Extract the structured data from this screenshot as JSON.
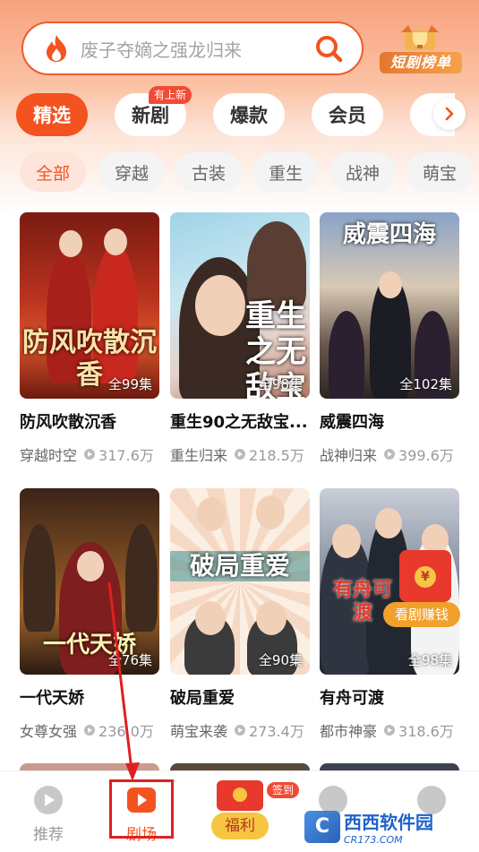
{
  "search": {
    "placeholder": "废子夺嫡之强龙归来"
  },
  "rank_badge": {
    "label": "短剧榜单"
  },
  "tabs": [
    {
      "label": "精选",
      "active": true
    },
    {
      "label": "新剧",
      "tag": "有上新"
    },
    {
      "label": "爆款"
    },
    {
      "label": "会员"
    }
  ],
  "filters": [
    "全部",
    "穿越",
    "古装",
    "重生",
    "战神",
    "萌宝"
  ],
  "cards": [
    {
      "title": "防风吹散沉香",
      "poster_text": "防风吹散沉香",
      "episodes": "全99集",
      "genre": "穿越时空",
      "views": "317.6万"
    },
    {
      "title": "重生90之无敌宝...",
      "poster_text": "重生之无敌宝",
      "episodes": "全98集",
      "genre": "重生归来",
      "views": "218.5万"
    },
    {
      "title": "威震四海",
      "poster_text": "威震四海",
      "episodes": "全102集",
      "genre": "战神归来",
      "views": "399.6万"
    },
    {
      "title": "一代天娇",
      "poster_text": "一代天娇",
      "episodes": "全76集",
      "genre": "女尊女强",
      "views": "236.0万"
    },
    {
      "title": "破局重爱",
      "poster_text": "破局重爱",
      "episodes": "全90集",
      "genre": "萌宝来袭",
      "views": "273.4万"
    },
    {
      "title": "有舟可渡",
      "poster_text": "有舟可渡",
      "episodes": "全98集",
      "genre": "都市神豪",
      "views": "318.6万"
    }
  ],
  "red_packet": {
    "coin": "¥",
    "label": "看剧赚钱"
  },
  "bottom_nav": [
    {
      "label": "推荐"
    },
    {
      "label": "剧场",
      "active": true
    },
    {
      "label": "福利",
      "tag": "签到"
    },
    {
      "label": ""
    },
    {
      "label": ""
    }
  ],
  "watermark": {
    "name": "西西软件园",
    "url": "CR173.COM"
  },
  "colors": {
    "accent": "#f2531f",
    "highlight": "#e02020"
  }
}
